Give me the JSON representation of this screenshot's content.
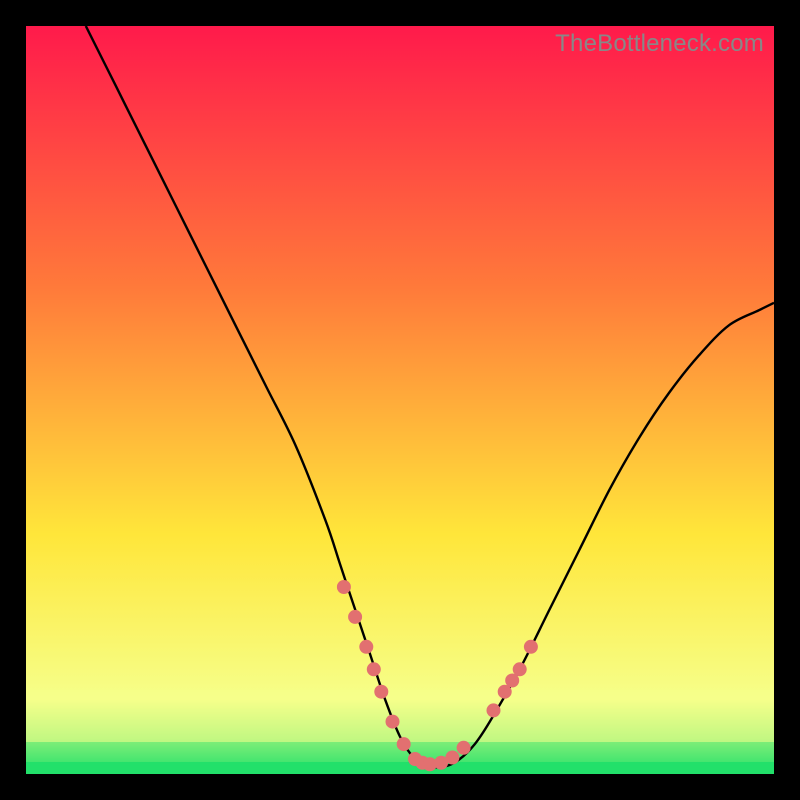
{
  "watermark": "TheBottleneck.com",
  "colors": {
    "frame": "#000000",
    "curve": "#000000",
    "marker": "#e27070",
    "gradient_top": "#ff1a4b",
    "gradient_mid1": "#ff7a3a",
    "gradient_mid2": "#ffe63a",
    "gradient_band": "#f6ff8a",
    "gradient_bottom": "#22e06a"
  },
  "chart_data": {
    "type": "line",
    "title": "",
    "xlabel": "",
    "ylabel": "",
    "xlim": [
      0,
      100
    ],
    "ylim": [
      0,
      100
    ],
    "grid": false,
    "legend": false,
    "series": [
      {
        "name": "bottleneck-curve",
        "x": [
          8,
          12,
          16,
          20,
          24,
          28,
          32,
          36,
          40,
          42,
          44,
          46,
          48,
          50,
          52,
          54,
          56,
          58,
          60,
          62,
          66,
          70,
          74,
          78,
          82,
          86,
          90,
          94,
          98,
          100
        ],
        "y": [
          100,
          92,
          84,
          76,
          68,
          60,
          52,
          44,
          34,
          28,
          22,
          16,
          10,
          5,
          2,
          1,
          1,
          2,
          4,
          7,
          14,
          22,
          30,
          38,
          45,
          51,
          56,
          60,
          62,
          63
        ]
      }
    ],
    "markers": {
      "name": "highlight-dots",
      "x": [
        42.5,
        44,
        45.5,
        46.5,
        47.5,
        49,
        50.5,
        52,
        53,
        54,
        55.5,
        57,
        58.5,
        62.5,
        64,
        65,
        66,
        67.5
      ],
      "y": [
        25,
        21,
        17,
        14,
        11,
        7,
        4,
        2,
        1.5,
        1.3,
        1.5,
        2.2,
        3.5,
        8.5,
        11,
        12.5,
        14,
        17
      ]
    }
  }
}
